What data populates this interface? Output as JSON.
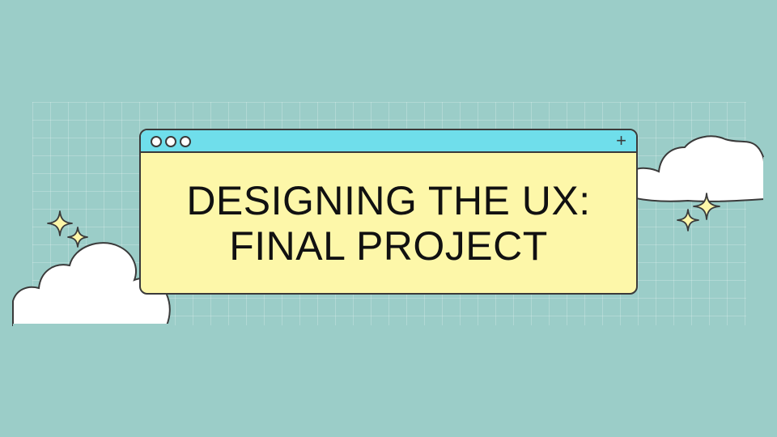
{
  "slide": {
    "title_line_1": "DESIGNING THE UX:",
    "title_line_2": "FINAL PROJECT"
  },
  "window": {
    "new_tab_glyph": "+"
  },
  "colors": {
    "background": "#9bcdc8",
    "titlebar": "#6fdeeb",
    "window_body": "#fdf7a9",
    "outline": "#3a3a3a",
    "sparkle": "#fdf7a9",
    "cloud": "#ffffff"
  },
  "icons": [
    "window-dot-icon",
    "plus-icon",
    "cloud-icon",
    "sparkle-icon"
  ]
}
